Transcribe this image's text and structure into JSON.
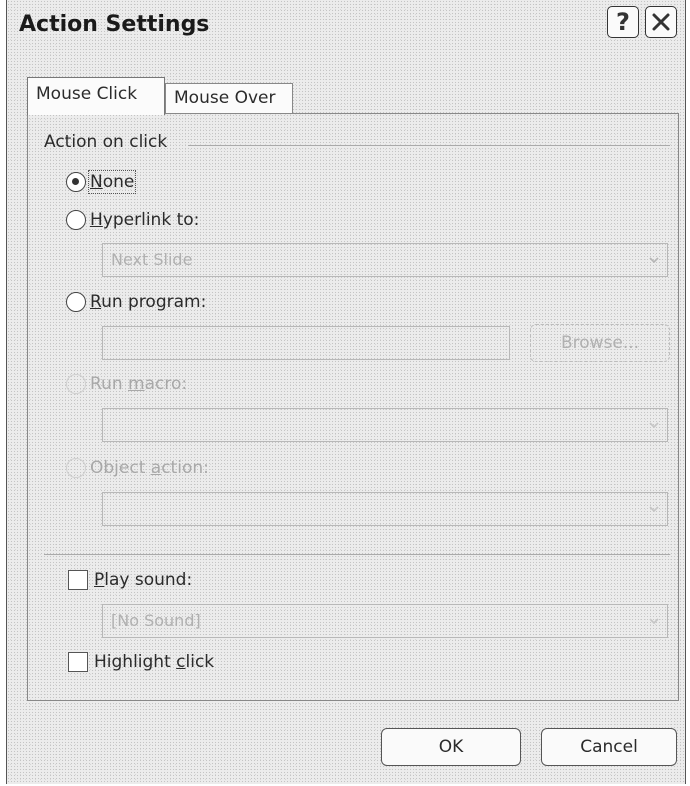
{
  "dialog": {
    "title": "Action Settings",
    "help_button": "?"
  },
  "tabs": [
    {
      "label": "Mouse Click",
      "active": true
    },
    {
      "label": "Mouse Over",
      "active": false
    }
  ],
  "group": {
    "label": "Action on click"
  },
  "options": {
    "none": {
      "label_u": "N",
      "label_rest": "one",
      "checked": true
    },
    "hyperlink": {
      "label_u": "H",
      "label_rest": "yperlink to:",
      "value": "Next Slide"
    },
    "run_program": {
      "label_u": "R",
      "label_rest": "un program:",
      "value": "",
      "browse": "Browse..."
    },
    "run_macro": {
      "label_pre": "Run ",
      "label_u": "m",
      "label_rest": "acro:",
      "value": ""
    },
    "object_action": {
      "label_pre": "Object ",
      "label_u": "a",
      "label_rest": "ction:",
      "value": ""
    }
  },
  "sound": {
    "label_u": "P",
    "label_rest": "lay sound:",
    "value": "[No Sound]",
    "checked": false
  },
  "highlight": {
    "label_pre": "Highlight ",
    "label_u": "c",
    "label_rest": "lick",
    "checked": false
  },
  "buttons": {
    "ok": "OK",
    "cancel": "Cancel"
  }
}
